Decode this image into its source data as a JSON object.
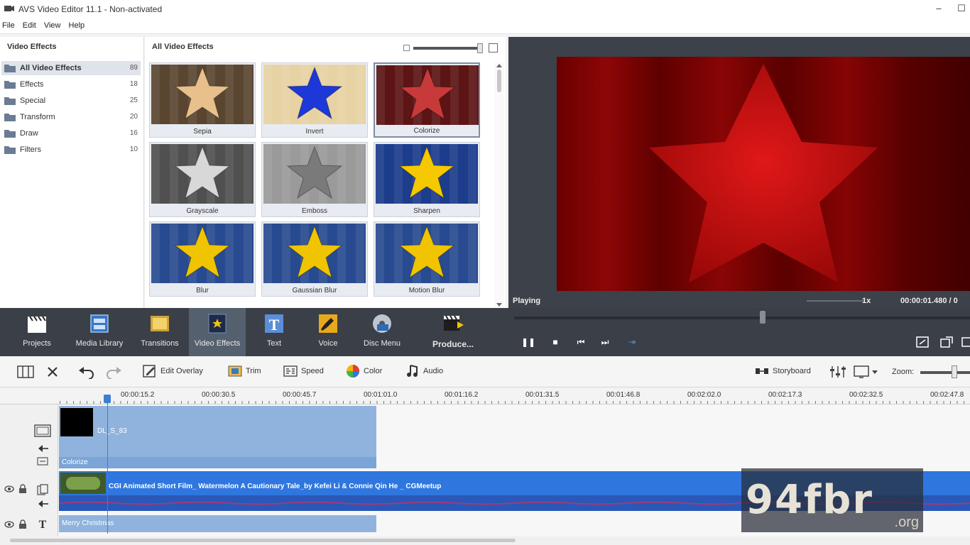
{
  "window": {
    "title": "AVS Video Editor 11.1 - Non-activated",
    "controls": [
      "–",
      "☐",
      "✕"
    ]
  },
  "menu": [
    "File",
    "Edit",
    "View",
    "Help"
  ],
  "tree": {
    "title": "Video Effects",
    "items": [
      {
        "label": "All Video Effects",
        "count": "89",
        "selected": true
      },
      {
        "label": "Effects",
        "count": "18"
      },
      {
        "label": "Special",
        "count": "25"
      },
      {
        "label": "Transform",
        "count": "20"
      },
      {
        "label": "Draw",
        "count": "16"
      },
      {
        "label": "Filters",
        "count": "10"
      }
    ]
  },
  "grid": {
    "title": "All Video Effects",
    "effects": [
      {
        "name": "Sepia",
        "bg": "#5a4630",
        "star": "#e8c08c"
      },
      {
        "name": "Invert",
        "bg": "#e6d2a2",
        "star": "#1d38d8"
      },
      {
        "name": "Colorize",
        "bg": "#5c1414",
        "star": "#c83a3a"
      },
      {
        "name": "Grayscale",
        "bg": "#505050",
        "star": "#d8d8d8"
      },
      {
        "name": "Emboss",
        "bg": "#9a9a9a",
        "star": "#7a7a7a"
      },
      {
        "name": "Sharpen",
        "bg": "#1c3c8c",
        "star": "#f5c800"
      },
      {
        "name": "Blur",
        "bg": "#284a90",
        "star": "#f0c400"
      },
      {
        "name": "Gaussian Blur",
        "bg": "#284a90",
        "star": "#f0c400"
      },
      {
        "name": "Motion Blur",
        "bg": "#284a90",
        "star": "#f0c400"
      }
    ]
  },
  "preview": {
    "status": "Playing",
    "speed": "1x",
    "timecode": "00:00:01.480 / 0"
  },
  "toolbar": {
    "buttons": [
      {
        "label": "Projects",
        "icon": "clapper-icon"
      },
      {
        "label": "Media Library",
        "icon": "media-library-icon"
      },
      {
        "label": "Transitions",
        "icon": "transitions-icon"
      },
      {
        "label": "Video Effects",
        "icon": "video-effects-icon",
        "active": true
      },
      {
        "label": "Text",
        "icon": "text-icon"
      },
      {
        "label": "Voice",
        "icon": "microphone-icon"
      },
      {
        "label": "Disc Menu",
        "icon": "disc-menu-icon"
      },
      {
        "label": "Produce...",
        "icon": "produce-icon"
      }
    ],
    "playback": [
      "❚❚",
      "■",
      "⏮",
      "⏭",
      "⇥"
    ]
  },
  "timeline_toolbar": {
    "edit_overlay": "Edit Overlay",
    "trim": "Trim",
    "speed": "Speed",
    "color": "Color",
    "audio": "Audio",
    "storyboard": "Storyboard",
    "zoom": "Zoom:"
  },
  "ruler": {
    "labels": [
      "00:00:15.2",
      "00:00:30.5",
      "00:00:45.7",
      "00:01:01.0",
      "00:01:16.2",
      "00:01:31.5",
      "00:01:46.8",
      "00:02:02.0",
      "00:02:17.3",
      "00:02:32.5",
      "00:02:47.8"
    ]
  },
  "tracks": {
    "overlay_clip": "DL_S_83",
    "overlay_effect": "Colorize",
    "main_clip": "CGI Animated Short Film_ Watermelon A Cautionary Tale_by Kefei Li & Connie Qin He _ CGMeetup",
    "text_clip": "Merry Christmas"
  },
  "colors": {
    "accent": "#3d7fcf",
    "dark_toolbar": "#3b3f47",
    "preview_bg": "#3d4149",
    "clip_blue": "#2f77df",
    "overlay_blue": "#8fb3dc"
  },
  "watermark": {
    "main": "94fbr",
    "sub": ".org"
  }
}
